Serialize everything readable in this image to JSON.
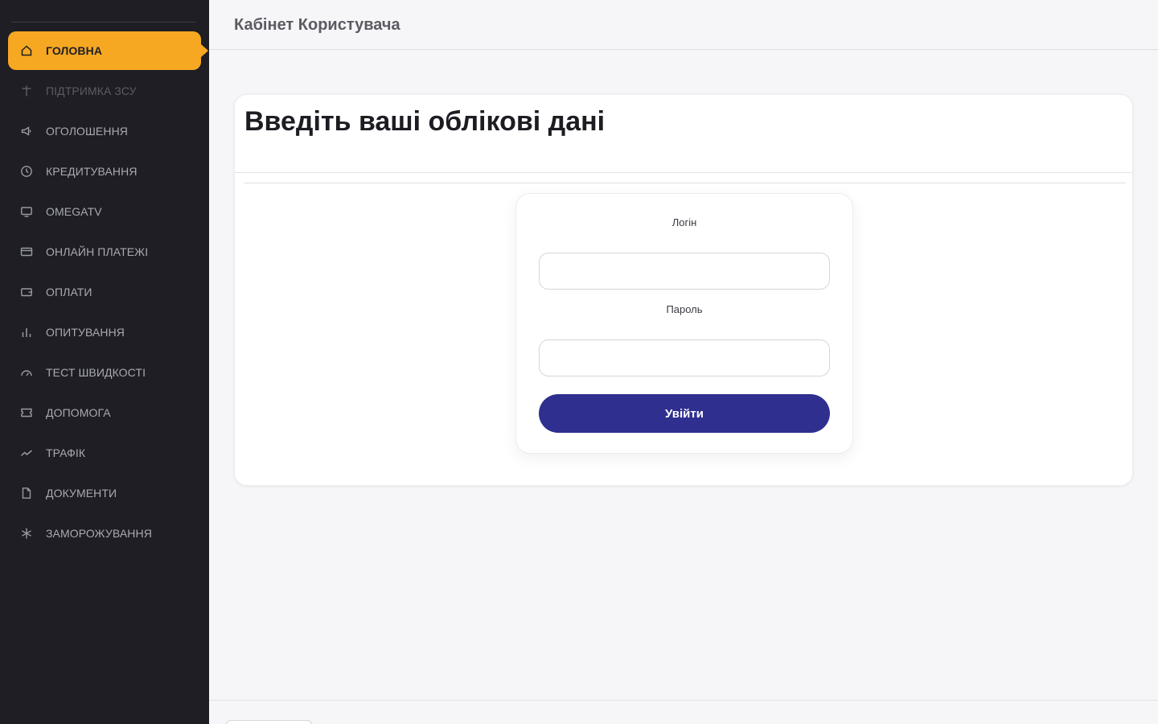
{
  "topbar": {
    "title": "Кабінет Користувача"
  },
  "sidebar": {
    "items": [
      {
        "label": "ГОЛОВНА",
        "icon": "home-icon",
        "state": "active"
      },
      {
        "label": "ПІДТРИМКА ЗСУ",
        "icon": "cross-icon",
        "state": "dim"
      },
      {
        "label": "ОГОЛОШЕННЯ",
        "icon": "megaphone-icon",
        "state": "normal"
      },
      {
        "label": "КРЕДИТУВАННЯ",
        "icon": "clock-icon",
        "state": "normal"
      },
      {
        "label": "OMEGATV",
        "icon": "tv-icon",
        "state": "normal"
      },
      {
        "label": "ОНЛАЙН ПЛАТЕЖІ",
        "icon": "credit-card-icon",
        "state": "normal"
      },
      {
        "label": "ОПЛАТИ",
        "icon": "wallet-icon",
        "state": "normal"
      },
      {
        "label": "ОПИТУВАННЯ",
        "icon": "bar-chart-icon",
        "state": "normal"
      },
      {
        "label": "ТЕСТ ШВИДКОСТІ",
        "icon": "speedometer-icon",
        "state": "normal"
      },
      {
        "label": "ДОПОМОГА",
        "icon": "ticket-icon",
        "state": "normal"
      },
      {
        "label": "ТРАФІК",
        "icon": "trend-line-icon",
        "state": "normal"
      },
      {
        "label": "ДОКУМЕНТИ",
        "icon": "document-icon",
        "state": "normal"
      },
      {
        "label": "ЗАМОРОЖУВАННЯ",
        "icon": "snowflake-icon",
        "state": "normal"
      }
    ]
  },
  "main": {
    "card_title": "Введіть ваші облікові дані",
    "login_form": {
      "login_label": "Логін",
      "login_value": "",
      "password_label": "Пароль",
      "password_value": "",
      "submit_label": "Увійти"
    }
  },
  "colors": {
    "sidebar_bg": "#1e1e24",
    "accent": "#f6a823",
    "button": "#2f2f8f"
  }
}
